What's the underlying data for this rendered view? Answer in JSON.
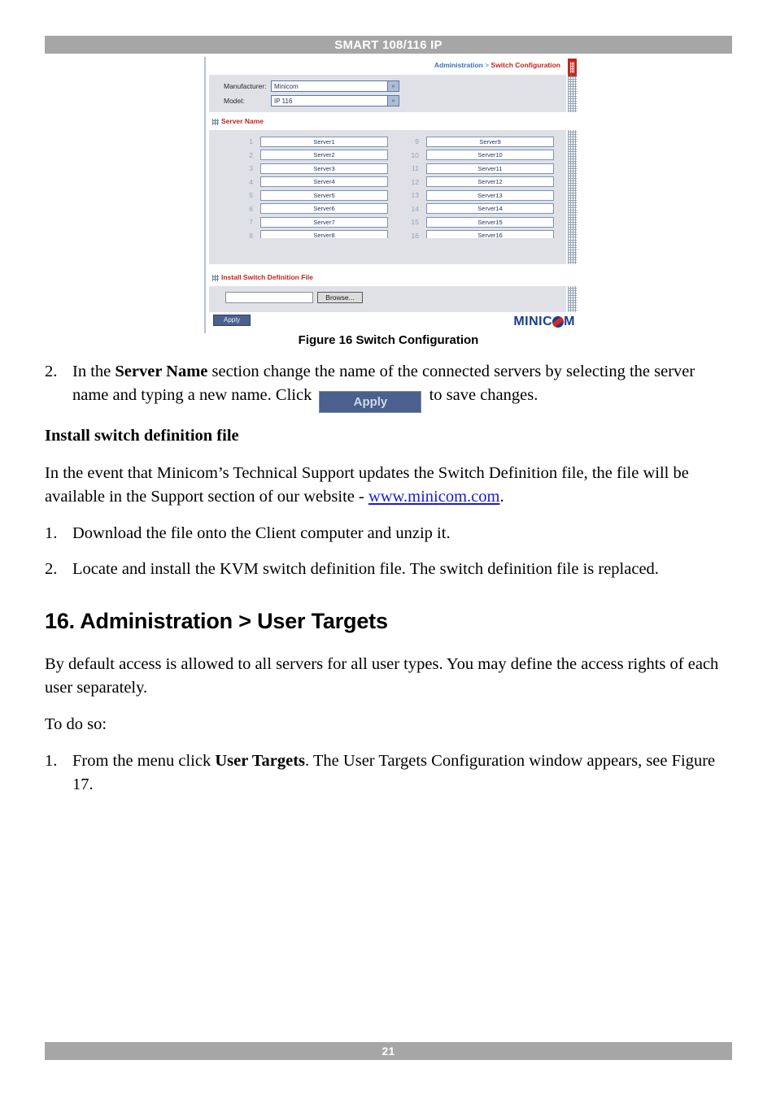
{
  "header": {
    "title": "SMART 108/116 IP"
  },
  "footer": {
    "page_number": "21"
  },
  "figure": {
    "caption": "Figure 16 Switch Configuration",
    "breadcrumb": {
      "root": "Administration",
      "separator": " > ",
      "current": "Switch Configuration"
    },
    "fields": {
      "manufacturer_label": "Manufacturer:",
      "manufacturer_value": "Minicom",
      "model_label": "Model:",
      "model_value": "IP 116",
      "dropdown_glyph": "»"
    },
    "server_name_section": {
      "heading": "Server Name"
    },
    "servers_left": [
      {
        "index": "1",
        "name": "Server1"
      },
      {
        "index": "2",
        "name": "Server2"
      },
      {
        "index": "3",
        "name": "Server3"
      },
      {
        "index": "4",
        "name": "Server4"
      },
      {
        "index": "5",
        "name": "Server5"
      },
      {
        "index": "6",
        "name": "Server6"
      },
      {
        "index": "7",
        "name": "Server7"
      },
      {
        "index": "8",
        "name": "Server8"
      }
    ],
    "servers_right": [
      {
        "index": "9",
        "name": "Server9"
      },
      {
        "index": "10",
        "name": "Server10"
      },
      {
        "index": "11",
        "name": "Server11"
      },
      {
        "index": "12",
        "name": "Server12"
      },
      {
        "index": "13",
        "name": "Server13"
      },
      {
        "index": "14",
        "name": "Server14"
      },
      {
        "index": "15",
        "name": "Server15"
      },
      {
        "index": "16",
        "name": "Server16"
      }
    ],
    "scrollbar": {
      "left_glyph": "◂",
      "right_glyph": "▸"
    },
    "apply_label": "Apply",
    "install_section": {
      "heading": "Install Switch Definition File"
    },
    "file_field_value": "",
    "browse_label": "Browse...",
    "logo": {
      "part1": "MINIC",
      "part2": "M"
    }
  },
  "content": {
    "step2": {
      "number": "2.",
      "text_a": "In the ",
      "bold_a": "Server Name",
      "text_b": " section change the name of the connected servers by selecting the server name and typing a new name. Click ",
      "apply_button_label": "Apply",
      "text_c": " to save changes."
    },
    "install_heading": "Install switch definition file",
    "install_para": {
      "text_a": "In the event that Minicom’s Technical Support updates the Switch Definition file, the file will be available in the Support section of our website - ",
      "link": "www.minicom.com",
      "text_b": "."
    },
    "install_steps": [
      {
        "number": "1.",
        "text": "Download the file onto the Client computer and unzip it."
      },
      {
        "number": "2.",
        "text": "Locate and install the KVM switch definition file. The switch definition file is replaced."
      }
    ],
    "chapter_heading": "16. Administration > User Targets",
    "chapter_para": "By default access is allowed to all servers for all user types. You may define the access rights of each user separately.",
    "todo_line": "To do so:",
    "final_step": {
      "number": "1.",
      "text_a": "From the menu click ",
      "bold": "User Targets",
      "text_b": ". The User Targets Configuration window appears, see Figure 17."
    }
  }
}
